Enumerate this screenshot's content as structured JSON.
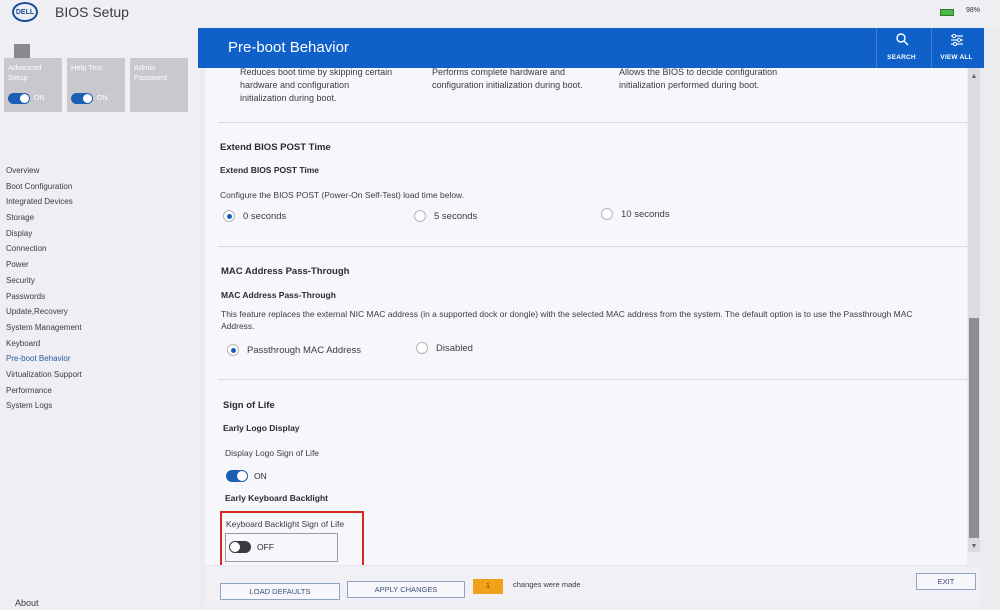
{
  "app": {
    "logo": "DELL",
    "title": "BIOS Setup",
    "battery": "98%"
  },
  "tiles": [
    {
      "label": "Advanced Setup",
      "toggle": "ON"
    },
    {
      "label": "Help Text",
      "toggle": "ON"
    },
    {
      "label": "Admin Password"
    }
  ],
  "nav": [
    "Overview",
    "Boot Configuration",
    "Integrated Devices",
    "Storage",
    "Display",
    "Connection",
    "Power",
    "Security",
    "Passwords",
    "Update,Recovery",
    "System Management",
    "Keyboard",
    "Pre-boot Behavior",
    "Virtualization Support",
    "Performance",
    "System Logs"
  ],
  "nav_active": "Pre-boot Behavior",
  "about": "About",
  "header": {
    "title": "Pre-boot Behavior",
    "search": "SEARCH",
    "view_all": "VIEW ALL"
  },
  "prev_section": {
    "col1": [
      "Reduces boot time by skipping certain",
      "hardware and configuration",
      "initialization during boot."
    ],
    "col2": [
      "Performs complete hardware and",
      "configuration initialization during boot."
    ],
    "col3": [
      "Allows the BIOS to decide configuration",
      "initialization performed during boot."
    ]
  },
  "extend_post": {
    "title": "Extend BIOS POST Time",
    "subtitle": "Extend BIOS POST Time",
    "desc": "Configure the BIOS POST (Power-On Self-Test) load time below.",
    "options": [
      "0 seconds",
      "5 seconds",
      "10 seconds"
    ],
    "selected": "0 seconds"
  },
  "mac_passthrough": {
    "title": "MAC Address Pass-Through",
    "subtitle": "MAC Address Pass-Through",
    "desc_line1": "This feature replaces the external NIC MAC address (in a supported dock or dongle) with the selected MAC address from the system. The default option is to use the Passthrough MAC",
    "desc_line2": "Address.",
    "options": [
      "Passthrough MAC Address",
      "Disabled"
    ],
    "selected": "Passthrough MAC Address"
  },
  "sign_of_life": {
    "title": "Sign of Life",
    "early_logo_title": "Early Logo Display",
    "early_logo_label": "Display Logo Sign of Life",
    "early_logo_state": "ON",
    "early_kb_title": "Early Keyboard Backlight",
    "early_kb_label": "Keyboard Backlight Sign of Life",
    "early_kb_state": "OFF"
  },
  "bottom": {
    "load_defaults": "LOAD DEFAULTS",
    "apply_changes": "APPLY CHANGES",
    "changes_count": "1",
    "changes_text": "changes were made",
    "exit": "EXIT"
  },
  "colors": {
    "header_blue": "#1060c9",
    "toggle_blue": "#1a5fb4",
    "highlight_red": "#d7261e",
    "badge_orange": "#f1a11c"
  }
}
